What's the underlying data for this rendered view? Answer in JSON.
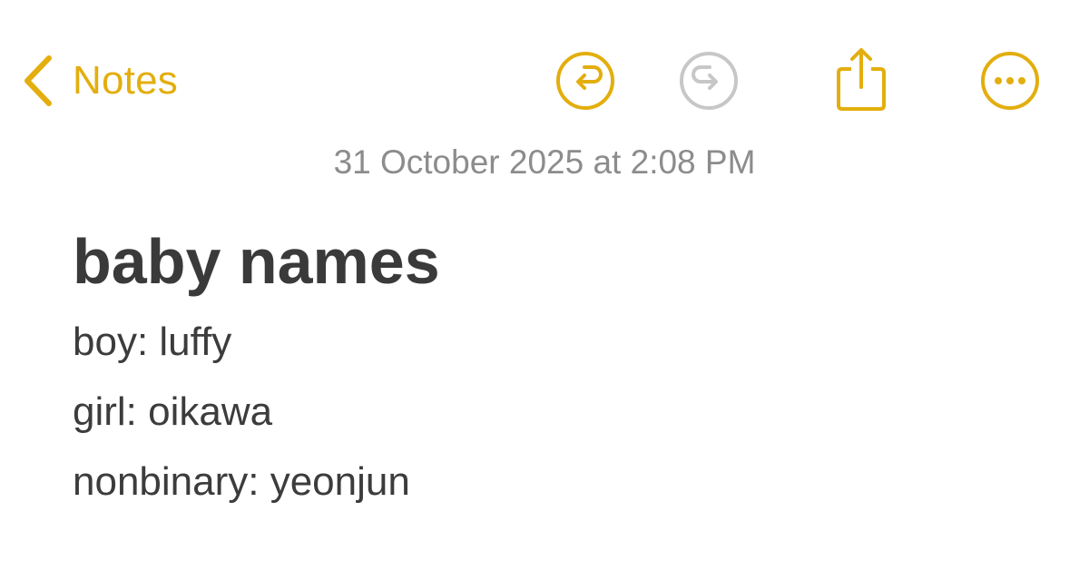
{
  "toolbar": {
    "back_label": "Notes",
    "back_icon": "chevron-left-icon",
    "undo_icon": "undo-icon",
    "redo_icon": "redo-icon",
    "share_icon": "share-icon",
    "more_icon": "ellipsis-icon",
    "redo_enabled": false,
    "accent_color": "#E3AE0E",
    "disabled_color": "#C7C7C7"
  },
  "note": {
    "date": "31 October 2025 at 2:08 PM",
    "title": "baby names",
    "lines": [
      "boy: luffy",
      "girl: oikawa",
      "nonbinary: yeonjun"
    ]
  }
}
